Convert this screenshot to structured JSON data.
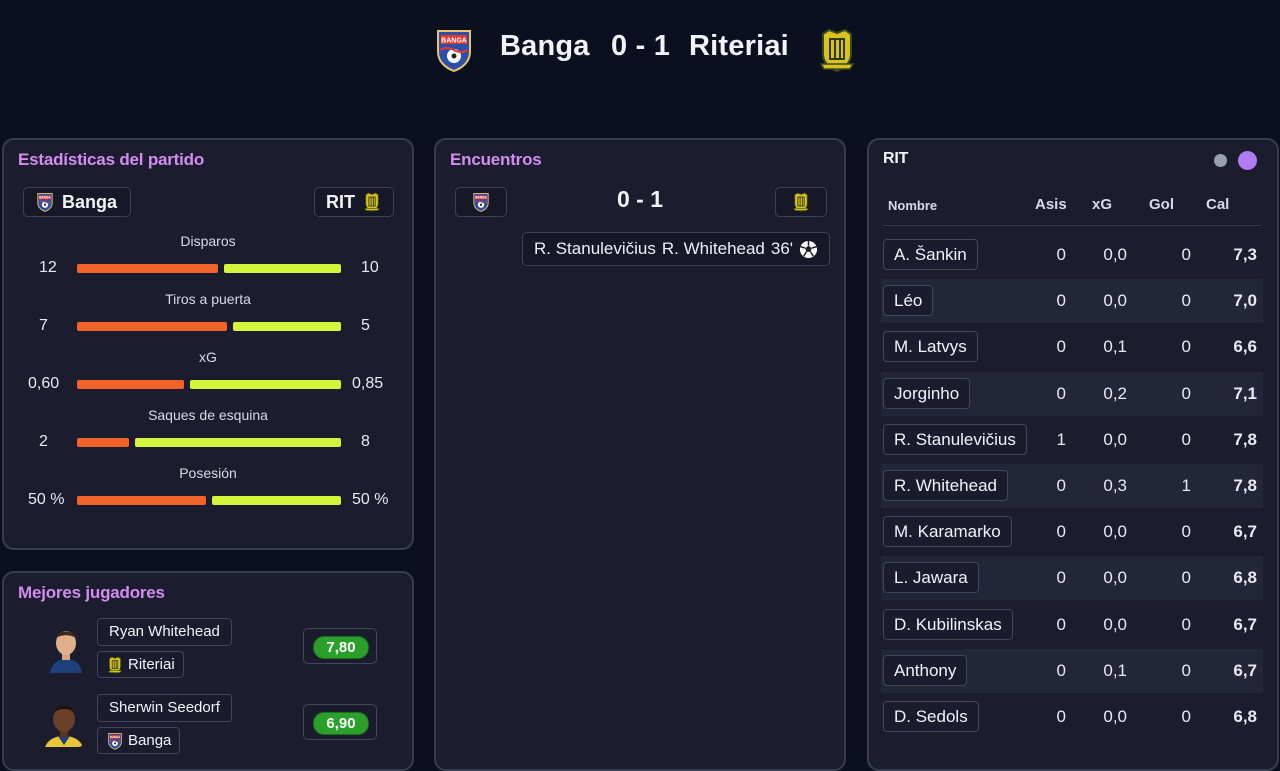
{
  "match": {
    "home_name": "Banga",
    "score": "0 - 1",
    "away_name": "Riteriai",
    "home_logo": "banga-crest-icon",
    "away_logo": "riteriai-crest-icon"
  },
  "stats_panel": {
    "title": "Estadísticas del partido",
    "home_chip": "Banga",
    "away_chip": "RIT",
    "rows": [
      {
        "label": "Disparos",
        "home": "12",
        "away": "10",
        "home_share": 0.545
      },
      {
        "label": "Tiros a puerta",
        "home": "7",
        "away": "5",
        "home_share": 0.583
      },
      {
        "label": "xG",
        "home": "0,60",
        "away": "0,85",
        "home_share": 0.414
      },
      {
        "label": "Saques de esquina",
        "home": "2",
        "away": "8",
        "home_share": 0.2
      },
      {
        "label": "Posesión",
        "home": "50 %",
        "away": "50 %",
        "home_share": 0.5
      }
    ],
    "colors": {
      "home": "#f0642a",
      "away": "#d4f53a"
    }
  },
  "encounters": {
    "title": "Encuentros",
    "score": "0 - 1",
    "event": {
      "assist": "R. Stanulevičius",
      "scorer": "R. Whitehead",
      "minute": "36'",
      "icon": "football-icon"
    }
  },
  "players_panel": {
    "team": "RIT",
    "headers": {
      "name": "Nombre",
      "assists": "Asis",
      "xg": "xG",
      "goals": "Gol",
      "rating": "Cal"
    },
    "rows": [
      {
        "name": "A. Šankin",
        "assists": "0",
        "xg": "0,0",
        "goals": "0",
        "rating": "7,3"
      },
      {
        "name": "Léo",
        "assists": "0",
        "xg": "0,0",
        "goals": "0",
        "rating": "7,0"
      },
      {
        "name": "M. Latvys",
        "assists": "0",
        "xg": "0,1",
        "goals": "0",
        "rating": "6,6"
      },
      {
        "name": "Jorginho",
        "assists": "0",
        "xg": "0,2",
        "goals": "0",
        "rating": "7,1"
      },
      {
        "name": "R. Stanulevičius",
        "assists": "1",
        "xg": "0,0",
        "goals": "0",
        "rating": "7,8"
      },
      {
        "name": "R. Whitehead",
        "assists": "0",
        "xg": "0,3",
        "goals": "1",
        "rating": "7,8"
      },
      {
        "name": "M. Karamarko",
        "assists": "0",
        "xg": "0,0",
        "goals": "0",
        "rating": "6,7"
      },
      {
        "name": "L. Jawara",
        "assists": "0",
        "xg": "0,0",
        "goals": "0",
        "rating": "6,8"
      },
      {
        "name": "D. Kubilinskas",
        "assists": "0",
        "xg": "0,0",
        "goals": "0",
        "rating": "6,7"
      },
      {
        "name": "Anthony",
        "assists": "0",
        "xg": "0,1",
        "goals": "0",
        "rating": "6,7"
      },
      {
        "name": "D. Sedols",
        "assists": "0",
        "xg": "0,0",
        "goals": "0",
        "rating": "6,8"
      }
    ],
    "toggle_colors": {
      "inactive": "#9aa0aa",
      "active": "#b07cf2"
    }
  },
  "best_players": {
    "title": "Mejores jugadores",
    "players": [
      {
        "name": "Ryan Whitehead",
        "team": "Riteriai",
        "rating": "7,80"
      },
      {
        "name": "Sherwin Seedorf",
        "team": "Banga",
        "rating": "6,90"
      }
    ]
  }
}
